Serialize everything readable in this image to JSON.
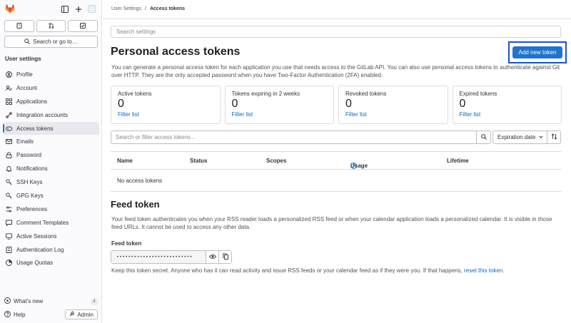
{
  "sidebar": {
    "search_label": "Search or go to…",
    "heading": "User settings",
    "items": [
      {
        "label": "Profile",
        "icon": "profile-icon"
      },
      {
        "label": "Account",
        "icon": "account-icon"
      },
      {
        "label": "Applications",
        "icon": "applications-icon"
      },
      {
        "label": "Integration accounts",
        "icon": "integration-icon"
      },
      {
        "label": "Access tokens",
        "icon": "token-icon",
        "active": true
      },
      {
        "label": "Emails",
        "icon": "email-icon"
      },
      {
        "label": "Password",
        "icon": "lock-icon"
      },
      {
        "label": "Notifications",
        "icon": "notifications-icon"
      },
      {
        "label": "SSH Keys",
        "icon": "key-icon"
      },
      {
        "label": "GPG Keys",
        "icon": "key-icon"
      },
      {
        "label": "Preferences",
        "icon": "preferences-icon"
      },
      {
        "label": "Comment Templates",
        "icon": "comment-icon"
      },
      {
        "label": "Active Sessions",
        "icon": "monitor-icon"
      },
      {
        "label": "Authentication Log",
        "icon": "log-icon"
      },
      {
        "label": "Usage Quotas",
        "icon": "quota-icon"
      }
    ],
    "whats_new": "What's new",
    "whats_new_count": "4",
    "help": "Help",
    "admin": "Admin"
  },
  "breadcrumb": {
    "parent": "User Settings",
    "separator": "/",
    "current": "Access tokens"
  },
  "search_settings_placeholder": "Search settings",
  "page": {
    "title": "Personal access tokens",
    "add_button": "Add new token",
    "description": "You can generate a personal access token for each application you use that needs access to the GitLab API. You can also use personal access tokens to authenticate against Git over HTTP. They are the only accepted password when you have Two-Factor Authentication (2FA) enabled."
  },
  "cards": [
    {
      "label": "Active tokens",
      "count": "0",
      "link": "Filter list"
    },
    {
      "label": "Tokens expiring in 2 weeks",
      "count": "0",
      "link": "Filter list"
    },
    {
      "label": "Revoked tokens",
      "count": "0",
      "link": "Filter list"
    },
    {
      "label": "Expired tokens",
      "count": "0",
      "link": "Filter list"
    }
  ],
  "filter": {
    "placeholder": "Search or filter access tokens...",
    "sort_label": "Expiration date"
  },
  "table": {
    "columns": [
      "Name",
      "Status",
      "Scopes",
      "Usage",
      "Lifetime"
    ],
    "empty": "No access tokens"
  },
  "feed": {
    "title": "Feed token",
    "description": "Your feed token authenticates you when your RSS reader loads a personalized RSS feed or when your calendar application loads a personalized calendar. It is visible in those feed URLs. It cannot be used to access any other data.",
    "label": "Feed token",
    "value": "••••••••••••••••••••••••••",
    "note_prefix": "Keep this token secret. Anyone who has it can read activity and issue RSS feeds or your calendar feed as if they were you. If that happens,",
    "note_link": "reset this token",
    "note_suffix": "."
  },
  "colors": {
    "accent": "#1f75cb",
    "link": "#1068bf",
    "highlight_box": "#1d4fd8",
    "logo": "#e24329"
  }
}
